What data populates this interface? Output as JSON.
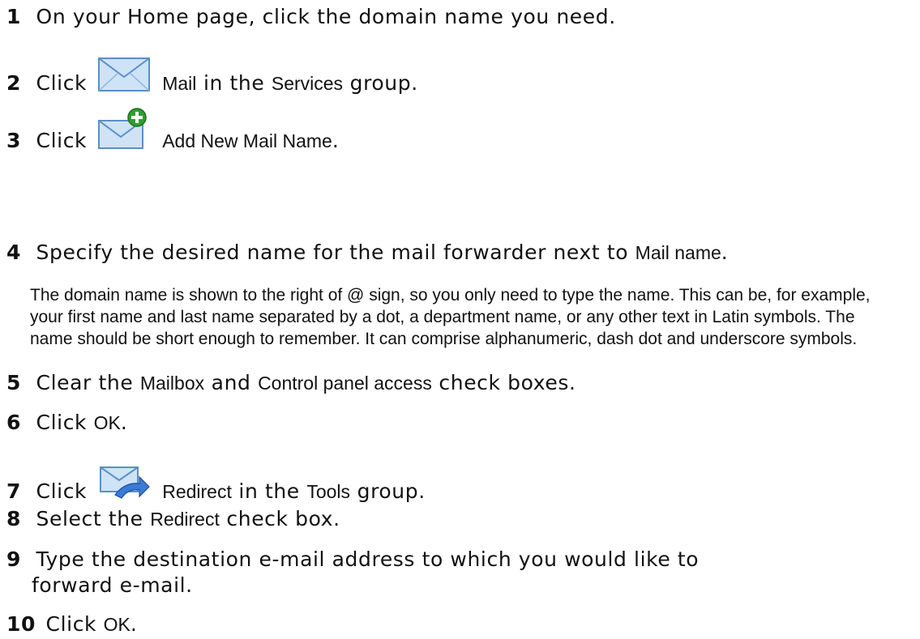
{
  "steps": [
    {
      "num": "1",
      "parts": [
        "On your Home page, click the domain name you need."
      ]
    },
    {
      "num": "2",
      "pre": "Click",
      "icon": "mail-icon",
      "term1": "Mail",
      "mid": "in the",
      "term2": "Services",
      "post": "group."
    },
    {
      "num": "3",
      "pre": "Click",
      "icon": "add-mail-icon",
      "term1": "Add New Mail Name",
      "post": "."
    },
    {
      "num": "4",
      "pre": "Specify the desired name for the mail forwarder next to",
      "term1": "Mail name",
      "post": "."
    },
    {
      "num": "5",
      "pre": "Clear the",
      "term1": "Mailbox",
      "mid": "and",
      "term2": "Control panel access",
      "post": "check boxes."
    },
    {
      "num": "6",
      "pre": "Click",
      "term1": "OK",
      "post": "."
    },
    {
      "num": "7",
      "pre": "Click",
      "icon": "redirect-icon",
      "term1": "Redirect",
      "mid": "in the",
      "term2": "Tools",
      "post": "group."
    },
    {
      "num": "8",
      "pre": "Select the",
      "term1": "Redirect",
      "post": "check box."
    },
    {
      "num": "9",
      "line1": "Type the destination e-mail address to which you would like to",
      "line2": "forward e-mail."
    },
    {
      "num": "10",
      "pre": "Click",
      "term1": "OK",
      "post": "."
    }
  ],
  "note": "The domain name is shown to the right of @ sign, so you only need to type the name. This can be, for example, your first name and last name separated by a dot, a department name, or any other text in Latin symbols. The name should be short enough to remember. It can comprise alphanumeric, dash dot and underscore symbols.",
  "colors": {
    "icon_fill": "#cfe3f7",
    "icon_stroke": "#5b8fc7",
    "plus_green": "#2f9e2f",
    "arrow_blue": "#3a7bd5"
  }
}
